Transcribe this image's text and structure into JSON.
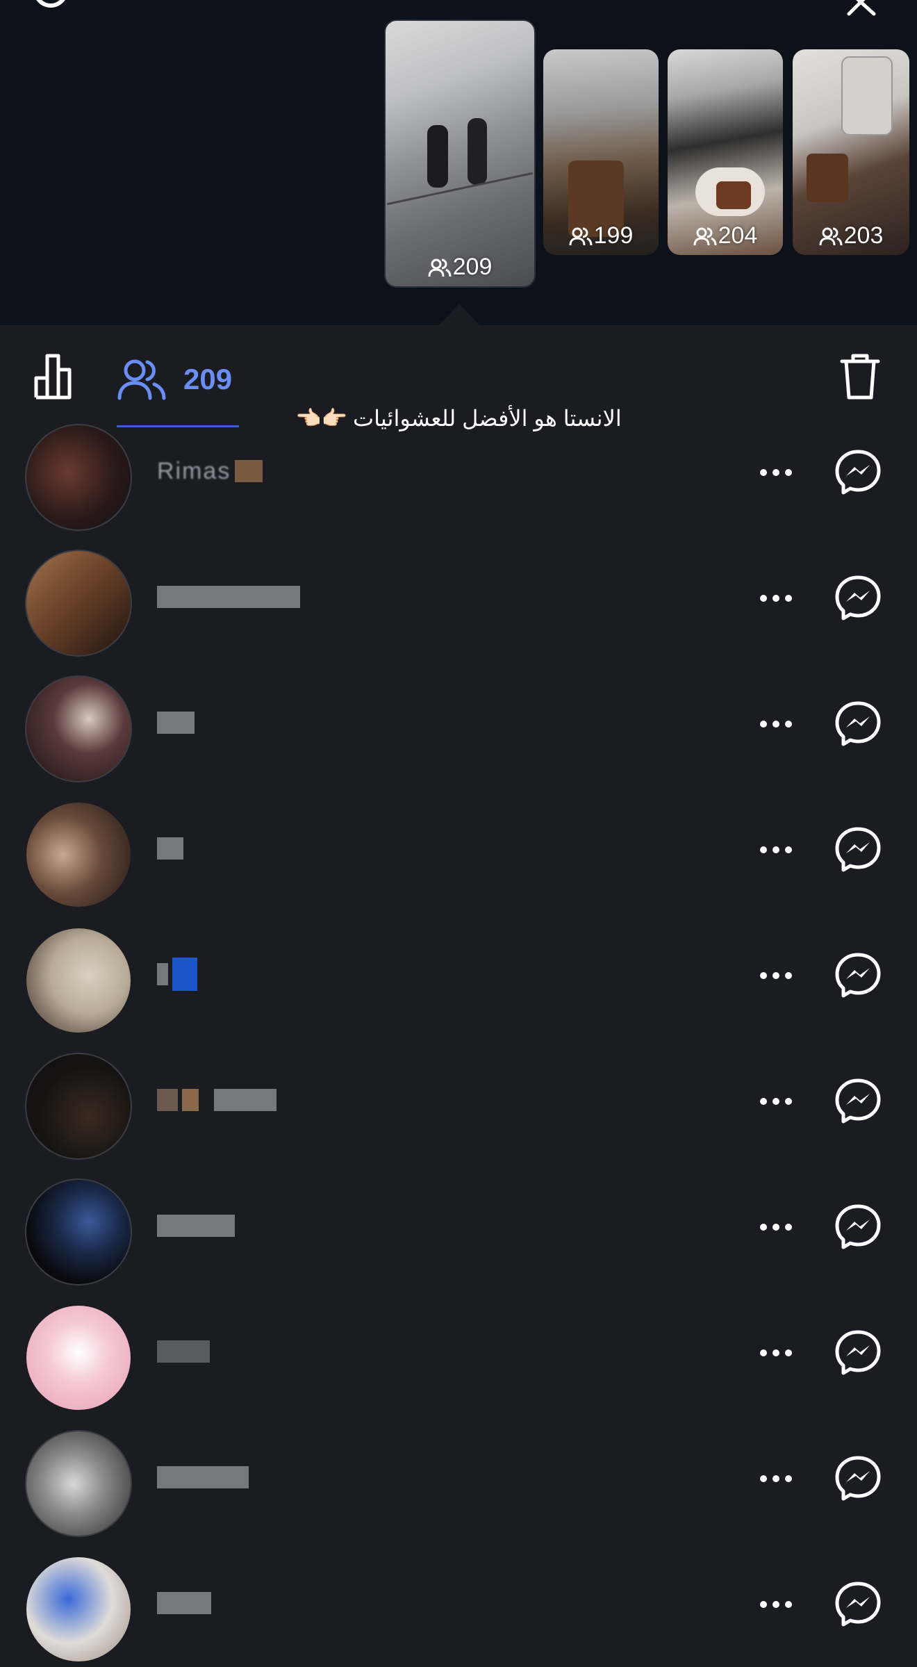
{
  "top": {
    "icons": [
      "gear-icon",
      "close-icon"
    ],
    "stories": [
      {
        "viewers": "209"
      },
      {
        "viewers": "199"
      },
      {
        "viewers": "204"
      },
      {
        "viewers": "203"
      }
    ]
  },
  "toolbar": {
    "icons": [
      "bar-chart-icon",
      "people-icon",
      "trash-icon"
    ],
    "viewers_count": "209"
  },
  "overlay": {
    "caption": "الانستا هو الأفضل للعشوائيات",
    "emoji": "👉🏻👈🏻"
  },
  "viewers": [
    {
      "username": "Rimas"
    },
    {
      "username": ""
    },
    {
      "username": ""
    },
    {
      "username": ""
    },
    {
      "username": ""
    },
    {
      "username": ""
    },
    {
      "username": ""
    },
    {
      "username": ""
    },
    {
      "username": ""
    },
    {
      "username": ""
    }
  ],
  "colors": {
    "accent": "#6b8ef5",
    "background": "#1a1c22",
    "top_background": "#0d1119"
  }
}
